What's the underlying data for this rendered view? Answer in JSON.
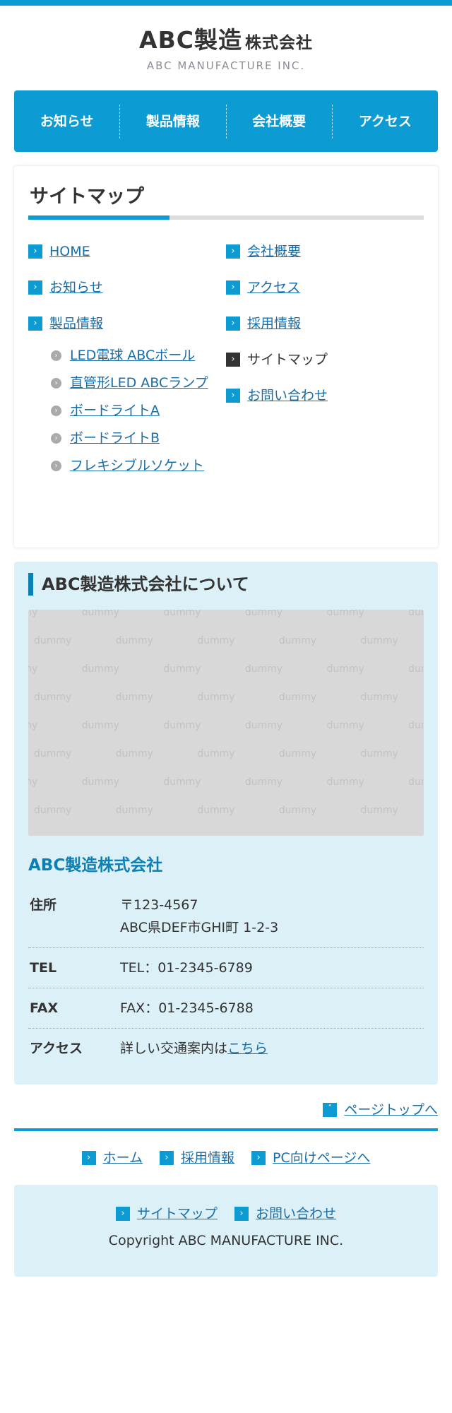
{
  "header": {
    "logo_main": "ABC製造",
    "logo_suffix": "株式会社",
    "logo_sub": "ABC MANUFACTURE INC."
  },
  "gnav": [
    "お知らせ",
    "製品情報",
    "会社概要",
    "アクセス"
  ],
  "sitemap": {
    "title": "サイトマップ",
    "left": [
      {
        "label": "HOME"
      },
      {
        "label": "お知らせ"
      },
      {
        "label": "製品情報"
      }
    ],
    "products": [
      "LED電球 ABCボール",
      "直管形LED ABCランプ",
      "ボードライトA",
      "ボードライトB",
      "フレキシブルソケット"
    ],
    "right": [
      {
        "label": "会社概要"
      },
      {
        "label": "アクセス"
      },
      {
        "label": "採用情報"
      },
      {
        "label": "サイトマップ"
      },
      {
        "label": "お問い合わせ"
      }
    ]
  },
  "about": {
    "title": "ABC製造株式会社について",
    "image_text": "dummy",
    "company": "ABC製造株式会社",
    "rows": [
      {
        "key": "住所",
        "line1": "〒123-4567",
        "line2": "ABC県DEF市GHI町 1-2-3"
      },
      {
        "key": "TEL",
        "line1": "TEL：01-2345-6789"
      },
      {
        "key": "FAX",
        "line1": "FAX：01-2345-6788"
      },
      {
        "key": "アクセス",
        "line1": "詳しい交通案内は",
        "link": "こちら"
      }
    ]
  },
  "pagetop": "ページトップへ",
  "footer": {
    "links": [
      "ホーム",
      "採用情報",
      "PC向けページへ"
    ],
    "box_links": [
      "サイトマップ",
      "お問い合わせ"
    ],
    "copyright": "Copyright ABC MANUFACTURE INC."
  },
  "colors": {
    "accent": "#0c9bd2",
    "link": "#1a6ea8",
    "panel": "#dcf0f8"
  }
}
